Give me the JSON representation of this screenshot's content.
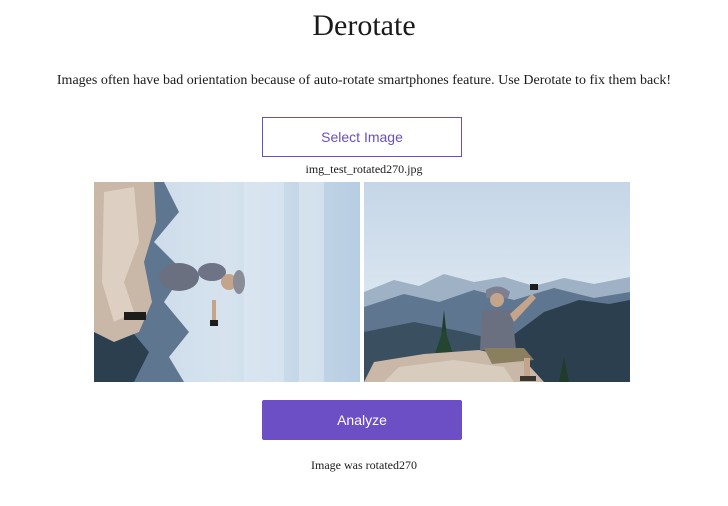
{
  "header": {
    "title": "Derotate",
    "description": "Images often have bad orientation because of auto-rotate smartphones feature. Use Derotate to fix them back!"
  },
  "upload": {
    "select_label": "Select Image",
    "filename": "img_test_rotated270.jpg"
  },
  "images": {
    "original": {
      "subject": "hiker-on-rock-photo",
      "rotation_degrees": 270
    },
    "corrected": {
      "subject": "hiker-on-rock-photo",
      "rotation_degrees": 0
    }
  },
  "actions": {
    "analyze_label": "Analyze"
  },
  "result": {
    "text": "Image was rotated270"
  },
  "colors": {
    "accent": "#6c4fc4",
    "sky": "#b9cfe3",
    "mountain": "#5f7690",
    "forest": "#2c3f4f",
    "rock": "#c9b8a8"
  }
}
